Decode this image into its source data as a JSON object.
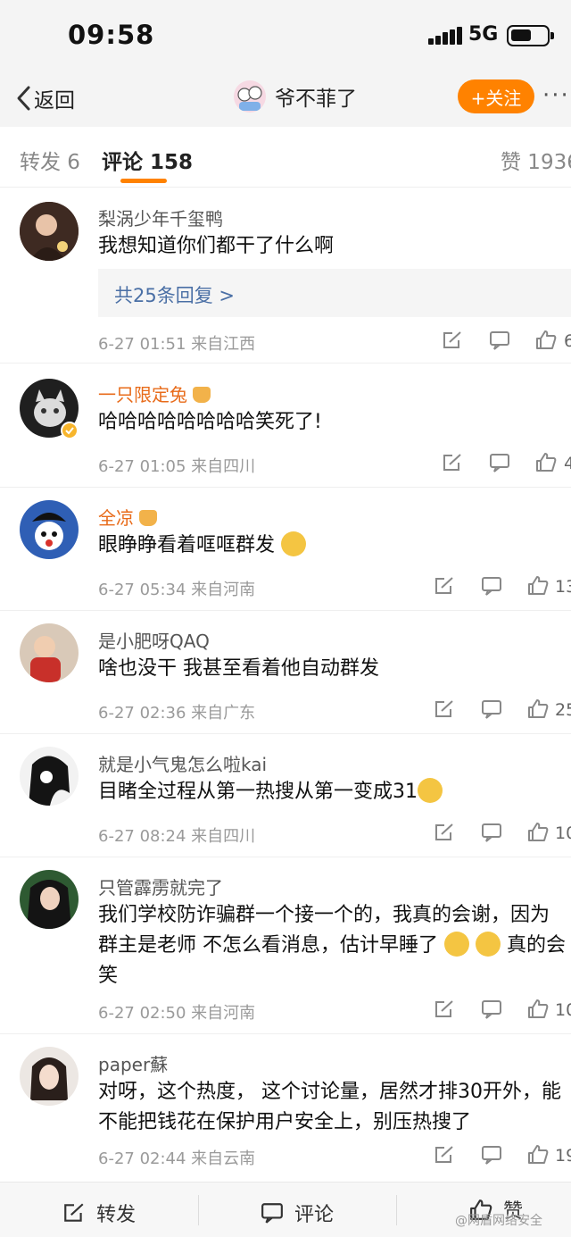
{
  "status_bar": {
    "time": "09:58",
    "network": "5G"
  },
  "nav": {
    "back_label": "返回",
    "title": "爷不菲了",
    "follow_label": "+关注",
    "more_label": "···"
  },
  "tabs": {
    "repost": "转发 6",
    "comment": "评论 158",
    "like": "赞 1936"
  },
  "comments": [
    {
      "user": "梨涡少年千玺鸭",
      "text": "我想知道你们都干了什么啊",
      "reply": "共25条回复 >",
      "meta": "6-27 01:51  来自江西",
      "likes": "6"
    },
    {
      "user": "一只限定兔",
      "text": "哈哈哈哈哈哈哈哈笑死了!",
      "meta": "6-27 01:05  来自四川",
      "likes": "4"
    },
    {
      "user": "全凉",
      "text": "眼睁睁看着哐哐群发",
      "meta": "6-27 05:34  来自河南",
      "likes": "13"
    },
    {
      "user": "是小肥呀QAQ",
      "text": "啥也没干 我甚至看着他自动群发",
      "meta": "6-27 02:36  来自广东",
      "likes": "25"
    },
    {
      "user": "就是小气鬼怎么啦kai",
      "text": "目睹全过程从第一热搜从第一变成31",
      "meta": "6-27 08:24  来自四川",
      "likes": "10"
    },
    {
      "user": "只管霹雳就完了",
      "text": "我们学校防诈骗群一个接一个的，我真的会谢，因为群主是老师 不怎么看消息，估计早睡了",
      "text_tail": "真的会笑",
      "meta": "6-27 02:50  来自河南",
      "likes": "10"
    },
    {
      "user": "paper蘇",
      "text": "对呀，这个热度， 这个讨论量，居然才排30开外，能不能把钱花在保护用户安全上，别压热搜了",
      "meta": "6-27 02:44  来自云南",
      "likes": "19"
    }
  ],
  "bottom_bar": {
    "repost": "转发",
    "comment": "评论",
    "like": "赞",
    "watermark": "@网盾网络安全"
  },
  "colors": {
    "accent": "#ff8200",
    "link": "#4a6fa5",
    "vip_name": "#e86b1a"
  }
}
